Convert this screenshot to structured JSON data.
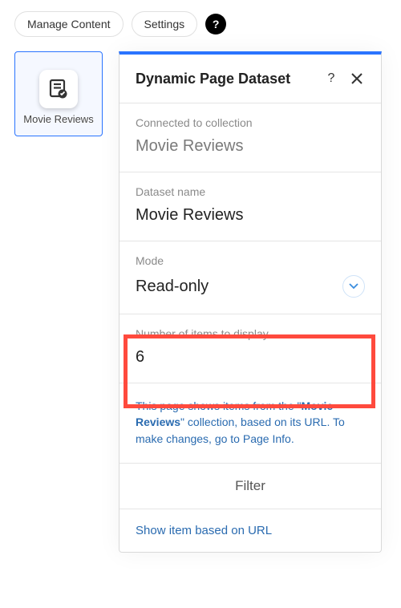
{
  "toolbar": {
    "manage_content": "Manage Content",
    "settings": "Settings",
    "help": "?"
  },
  "stage_element": {
    "label": "Movie Reviews"
  },
  "panel": {
    "title": "Dynamic Page Dataset",
    "help": "?",
    "close": "✕",
    "connected": {
      "label": "Connected to collection",
      "value": "Movie Reviews"
    },
    "dataset_name": {
      "label": "Dataset name",
      "value": "Movie Reviews"
    },
    "mode": {
      "label": "Mode",
      "value": "Read-only"
    },
    "items_count": {
      "label": "Number of items to display",
      "value": "6"
    },
    "info": {
      "prefix": "This page shows items from the \"",
      "collection": "Movie Reviews",
      "middle": "\" collection, based on its URL. To make changes, go to ",
      "link": "Page Info",
      "suffix": "."
    },
    "filter_label": "Filter",
    "show_item_link": "Show item based on URL"
  }
}
